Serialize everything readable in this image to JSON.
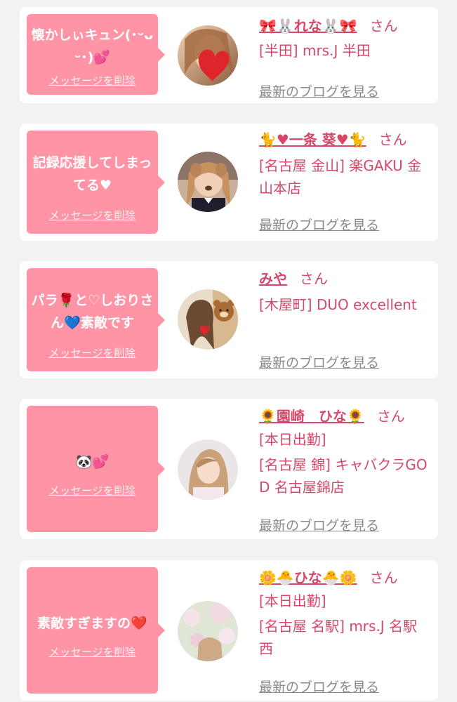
{
  "colors": {
    "background": "#f2f2f2",
    "card": "#ffffff",
    "bubble": "#ff94a6",
    "accent": "#d6486a",
    "link_gray": "#8a8a8a"
  },
  "entries": [
    {
      "message": "懐かしぃキュン(･ᵕᴗᵕ･)💕",
      "delete_label": "メッセージを削除",
      "name": "🎀🐰れな🐰🎀",
      "honorific": "さん",
      "lines": [
        "[半田] mrs.J 半田"
      ],
      "blog_label": "最新のブログを見る",
      "avatar_icon": "heart-sticker-icon"
    },
    {
      "message": "記録応援してしまってる♥",
      "delete_label": "メッセージを削除",
      "name": "🐈♥一条 葵♥🐈",
      "honorific": "さん",
      "lines": [
        "[名古屋 金山] 楽GAKU 金山本店"
      ],
      "blog_label": "最新のブログを見る",
      "avatar_icon": "dog-filter-icon"
    },
    {
      "message": "パラ🌹と♡しおりさん💙素敵です",
      "delete_label": "メッセージを削除",
      "name": "みや",
      "honorific": "さん",
      "lines": [
        "[木屋町] DUO excellent"
      ],
      "blog_label": "最新のブログを見る",
      "avatar_icon": "bear-sticker-icon"
    },
    {
      "message": "🐼💕",
      "delete_label": "メッセージを削除",
      "name": "🌻園崎　ひな🌻",
      "honorific": "さん",
      "lines": [
        "[本日出勤]",
        "[名古屋 錦] キャバクラGOD 名古屋錦店"
      ],
      "blog_label": "最新のブログを見る",
      "avatar_icon": "portrait-icon"
    },
    {
      "message": "素敵すぎますの❤️",
      "delete_label": "メッセージを削除",
      "name": "🌼🐣ひな🐣🌼",
      "honorific": "さん",
      "lines": [
        "[本日出勤]",
        "[名古屋 名駅] mrs.J 名駅西"
      ],
      "blog_label": "最新のブログを見る",
      "avatar_icon": "flower-portrait-icon"
    }
  ]
}
